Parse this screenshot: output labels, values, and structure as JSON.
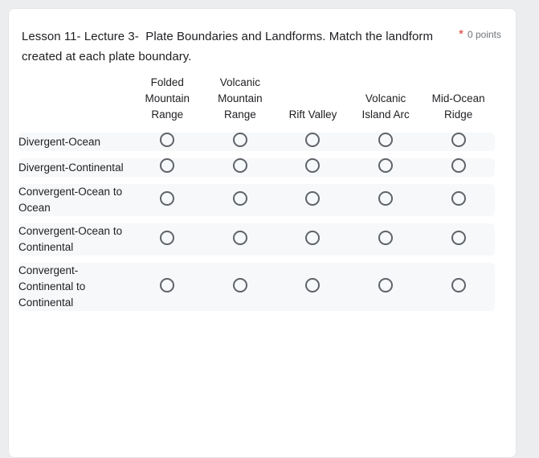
{
  "question": {
    "title": "Lesson 11- Lecture 3-  Plate Boundaries and Landforms. Match the landform created at each plate boundary.",
    "required_marker": "*",
    "points": "0 points"
  },
  "grid": {
    "columns": [
      "Folded Mountain Range",
      "Volcanic Mountain Range",
      "Rift Valley",
      "Volcanic Island Arc",
      "Mid-Ocean Ridge"
    ],
    "rows": [
      {
        "label": "Divergent-Ocean",
        "options": [
          {
            "value": "Folded Mountain Range",
            "selected": false
          },
          {
            "value": "Volcanic Mountain Range",
            "selected": false
          },
          {
            "value": "Rift Valley",
            "selected": false
          },
          {
            "value": "Volcanic Island Arc",
            "selected": false
          },
          {
            "value": "Mid-Ocean Ridge",
            "selected": false
          }
        ]
      },
      {
        "label": "Divergent-Continental",
        "options": [
          {
            "value": "Folded Mountain Range",
            "selected": false
          },
          {
            "value": "Volcanic Mountain Range",
            "selected": false
          },
          {
            "value": "Rift Valley",
            "selected": false
          },
          {
            "value": "Volcanic Island Arc",
            "selected": false
          },
          {
            "value": "Mid-Ocean Ridge",
            "selected": false
          }
        ]
      },
      {
        "label": "Convergent-Ocean to Ocean",
        "options": [
          {
            "value": "Folded Mountain Range",
            "selected": false
          },
          {
            "value": "Volcanic Mountain Range",
            "selected": false
          },
          {
            "value": "Rift Valley",
            "selected": false
          },
          {
            "value": "Volcanic Island Arc",
            "selected": false
          },
          {
            "value": "Mid-Ocean Ridge",
            "selected": false
          }
        ]
      },
      {
        "label": "Convergent-Ocean to Continental",
        "options": [
          {
            "value": "Folded Mountain Range",
            "selected": false
          },
          {
            "value": "Volcanic Mountain Range",
            "selected": false
          },
          {
            "value": "Rift Valley",
            "selected": false
          },
          {
            "value": "Volcanic Island Arc",
            "selected": false
          },
          {
            "value": "Mid-Ocean Ridge",
            "selected": false
          }
        ]
      },
      {
        "label": "Convergent-Continental to Continental",
        "options": [
          {
            "value": "Folded Mountain Range",
            "selected": false
          },
          {
            "value": "Volcanic Mountain Range",
            "selected": false
          },
          {
            "value": "Rift Valley",
            "selected": false
          },
          {
            "value": "Volcanic Island Arc",
            "selected": false
          },
          {
            "value": "Mid-Ocean Ridge",
            "selected": false
          }
        ]
      }
    ]
  },
  "colors": {
    "page_background": "#ebedef",
    "card_background": "#ffffff",
    "row_band": "#f6f8fa",
    "text_primary": "#202124",
    "text_secondary": "#70757a",
    "required_red": "#d93025",
    "radio_outline": "#5f6368"
  }
}
